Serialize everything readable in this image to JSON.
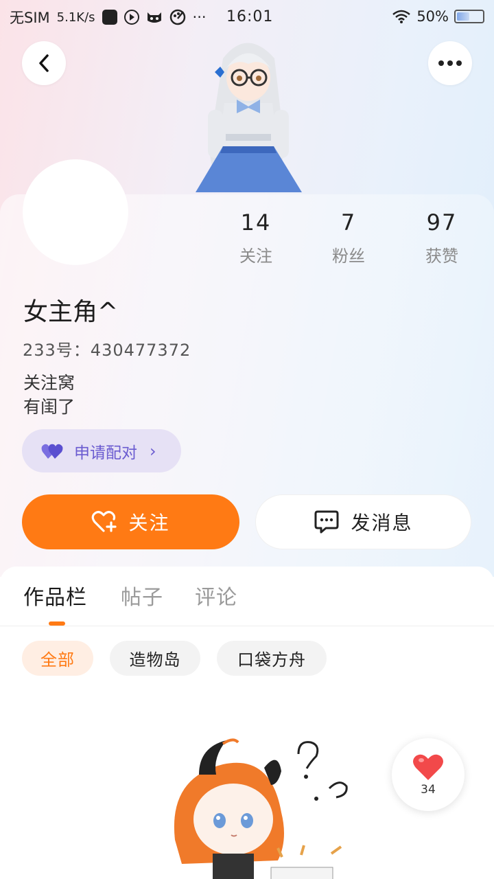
{
  "status_bar": {
    "carrier": "无SIM",
    "net_speed": "5.1K/s",
    "extra": "···",
    "time": "16:01",
    "battery": "50%",
    "battery_level": 0.5
  },
  "profile": {
    "stats": [
      {
        "value": "14",
        "label": "关注"
      },
      {
        "value": "7",
        "label": "粉丝"
      },
      {
        "value": "97",
        "label": "获赞"
      }
    ],
    "username": "女主角^",
    "id_line": "233号：430477372",
    "bio_lines": [
      "关注窝",
      "有闺了"
    ],
    "pair_label": "申请配对",
    "follow_label": "关注",
    "message_label": "发消息"
  },
  "tabs": [
    {
      "label": "作品栏",
      "active": true
    },
    {
      "label": "帖子",
      "active": false
    },
    {
      "label": "评论",
      "active": false
    }
  ],
  "filters": [
    {
      "label": "全部",
      "active": true
    },
    {
      "label": "造物岛",
      "active": false
    },
    {
      "label": "口袋方舟",
      "active": false
    }
  ],
  "like_button": {
    "count": "34"
  },
  "colors": {
    "accent": "#ff7a14",
    "pair_purple": "#6a5bd0",
    "heart_red": "#f2494a"
  }
}
